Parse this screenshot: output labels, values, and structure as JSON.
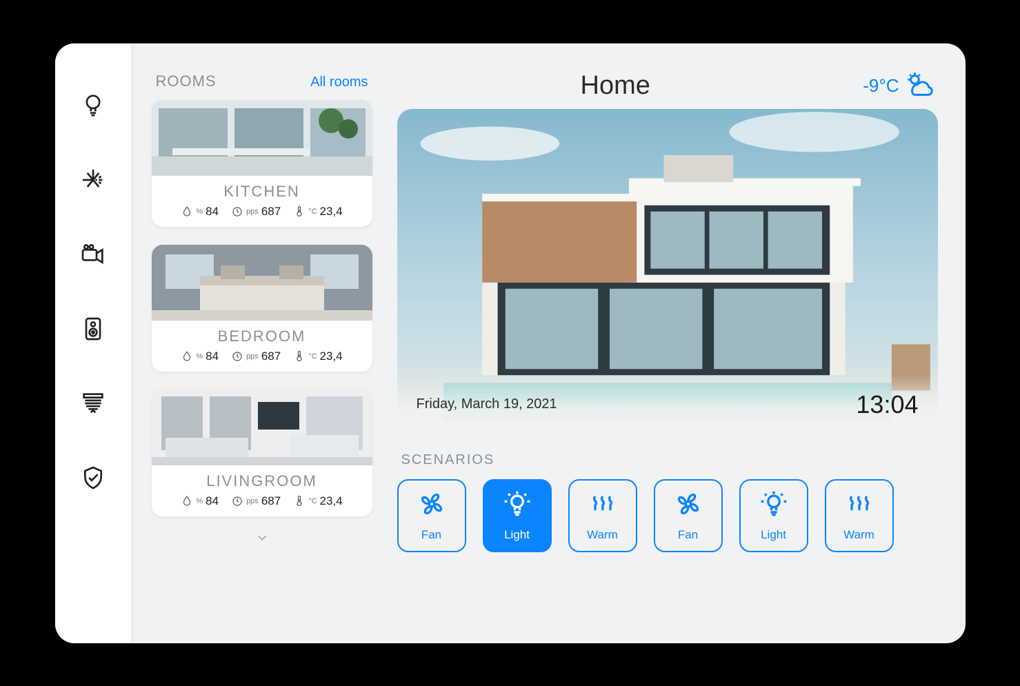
{
  "nav": [
    "light",
    "climate",
    "camera",
    "speaker",
    "blinds",
    "security"
  ],
  "rooms": {
    "title": "ROOMS",
    "link": "All rooms",
    "items": [
      {
        "name": "KITCHEN",
        "humidity": "84",
        "pps": "687",
        "temp": "23,4"
      },
      {
        "name": "BEDROOM",
        "humidity": "84",
        "pps": "687",
        "temp": "23,4"
      },
      {
        "name": "LIVINGROOM",
        "humidity": "84",
        "pps": "687",
        "temp": "23,4"
      }
    ]
  },
  "header": {
    "title": "Home",
    "weather_temp": "-9°C"
  },
  "hero": {
    "date": "Friday, March 19, 2021",
    "time": "13:04"
  },
  "scenarios": {
    "title": "SCENARIOS",
    "items": [
      {
        "label": "Fan",
        "icon": "fan",
        "active": false
      },
      {
        "label": "Light",
        "icon": "light",
        "active": true
      },
      {
        "label": "Warm",
        "icon": "warm",
        "active": false
      },
      {
        "label": "Fan",
        "icon": "fan",
        "active": false
      },
      {
        "label": "Light",
        "icon": "light",
        "active": false
      },
      {
        "label": "Warm",
        "icon": "warm",
        "active": false
      }
    ]
  },
  "stat_units": {
    "humidity": "%",
    "pps": "pps",
    "temp": "°C"
  }
}
